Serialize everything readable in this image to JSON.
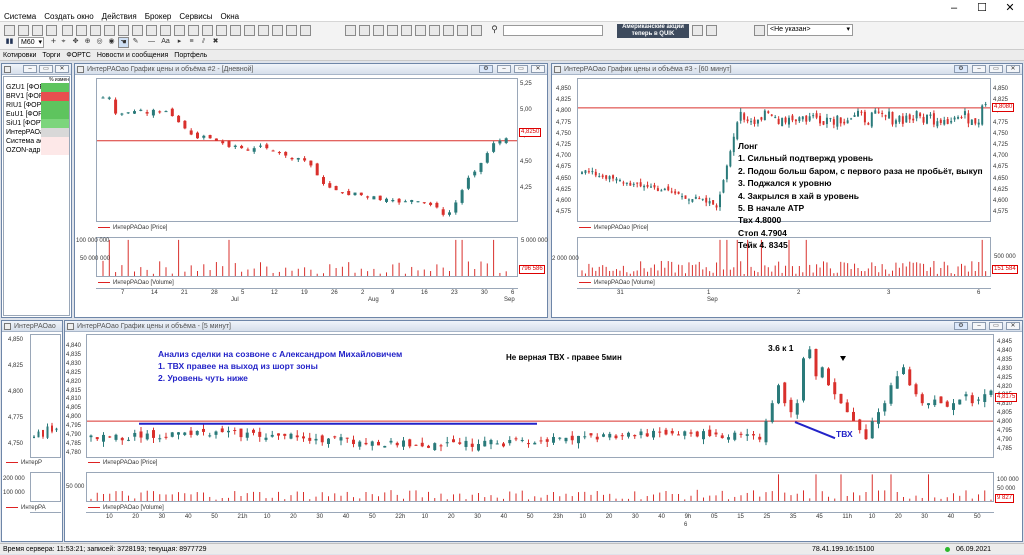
{
  "menu": {
    "items": [
      "Система",
      "Создать окно",
      "Действия",
      "Брокер",
      "Сервисы",
      "Окна"
    ]
  },
  "toolbar": {
    "interval": "M60",
    "banner_line1": "Американские акции",
    "banner_line2": "теперь в QUIK",
    "account_select": "<Не указан>"
  },
  "tabs": [
    "Котировки",
    "Торги",
    "ФОРТС",
    "Новости и сообщения",
    "Портфель"
  ],
  "watchlist": {
    "header": "% измен",
    "rows": [
      {
        "name": "GZU1 [ФОРТ",
        "color": "#5ec45e"
      },
      {
        "name": "BRV1 [ФОРТ",
        "color": "#e84f4f"
      },
      {
        "name": "RIU1 [ФОРТ",
        "color": "#5ec45e"
      },
      {
        "name": "EuU1 [ФОРТ",
        "color": "#5ec45e"
      },
      {
        "name": "SiU1 [ФОРТ",
        "color": "#7cd57c"
      },
      {
        "name": "ИнтерРАОао",
        "color": "#d8d8d8"
      },
      {
        "name": "Система ао",
        "color": "#fde8e8"
      },
      {
        "name": "OZON-адр [М",
        "color": "#fde8e8"
      }
    ]
  },
  "window_daily": {
    "title": "ИнтерРАОао График цены и объёма #2 - [Дневной]",
    "y_ticks": [
      "5,25",
      "5,00",
      "4,75",
      "4,50",
      "4,25"
    ],
    "last_price": "4,8250",
    "price_legend": "ИнтерРАОао [Price]",
    "volume_legend": "ИнтерРАОао [Volume]",
    "vol_ticks": [
      "100 000 000",
      "50 000 000"
    ],
    "vol_ticks_right": [
      "5 000 000",
      "0 000 000"
    ],
    "vol_box": "796 586",
    "x_days": [
      "7",
      "14",
      "21",
      "28",
      "5",
      "12",
      "19",
      "26",
      "2",
      "9",
      "16",
      "23",
      "30",
      "6"
    ],
    "x_months": [
      "Jul",
      "Aug",
      "Sep"
    ]
  },
  "window_60": {
    "title": "ИнтерРАОао График цены и объёма #3 - [60 минут]",
    "y_ticks": [
      "4,850",
      "4,825",
      "4,800",
      "4,775",
      "4,750",
      "4,725",
      "4,700",
      "4,675",
      "4,650",
      "4,625",
      "4,600",
      "4,575"
    ],
    "y_ticks_left": [
      "4,850",
      "4,825",
      "4,800",
      "4,775",
      "4,750",
      "4,725",
      "4,700",
      "4,675",
      "4,650",
      "4,625",
      "4,600",
      "4,575"
    ],
    "last_price": "4,8080",
    "price_legend": "ИнтерРАОао [Price]",
    "volume_legend": "ИнтерРАОао [Volume]",
    "vol_tick_left": "2 000 000",
    "vol_tick_right": "500 000",
    "vol_box": "151 584",
    "x_labels": [
      "31",
      "1",
      "2",
      "3",
      "6"
    ],
    "x_month": "Sep",
    "notes": [
      "Лонг",
      "1. Сильный подтвержд уровень",
      "2. Подош больш баром, с первого раза не пробьёт, выкуп",
      "3. Поджался к уровню",
      "4. Закрылся в хай в уровень",
      "5. В начале АТР",
      "Твх 4.8000",
      "Стоп 4.7904",
      "Тейк 4. 8345"
    ]
  },
  "window_small": {
    "title": "ИнтерРАОао",
    "y_ticks": [
      "4,850",
      "4,825",
      "4,800",
      "4,775",
      "4,750"
    ],
    "vol_ticks": [
      "200 000",
      "100 000"
    ],
    "price_legend": "ИнтерР",
    "volume_legend": "ИнтерРА"
  },
  "window_5m": {
    "title": "ИнтерРАОао График цены и объёма - [5 минут]",
    "y_ticks": [
      "4,845",
      "4,840",
      "4,835",
      "4,830",
      "4,825",
      "4,820",
      "4,815",
      "4,810",
      "4,805",
      "4,800",
      "4,795",
      "4,790",
      "4,785"
    ],
    "y_ticks_left": [
      "4,840",
      "4,835",
      "4,830",
      "4,825",
      "4,820",
      "4,815",
      "4,810",
      "4,805",
      "4,800",
      "4,795",
      "4,790",
      "4,785",
      "4,780"
    ],
    "last_price": "4,8175",
    "price_legend": "ИнтерРАОао [Price]",
    "volume_legend": "ИнтерРАОао [Volume]",
    "vol_tick_left": "50 000",
    "vol_ticks_right": [
      "100 000",
      "50 000"
    ],
    "vol_box": "9 827",
    "x_labels": [
      "10",
      "20",
      "30",
      "40",
      "50",
      "21h",
      "10",
      "20",
      "30",
      "40",
      "50",
      "22h",
      "10",
      "20",
      "30",
      "40",
      "50",
      "23h",
      "10",
      "20",
      "30",
      "40",
      "9h",
      "05",
      "15",
      "25",
      "35",
      "45",
      "11h",
      "10",
      "20",
      "30",
      "40",
      "50"
    ],
    "x_day": "6",
    "note_blue_1": "Анализ сделки на созвоне с Александром Михайловичем",
    "note_blue_2": "1. ТВХ правее на выход из шорт зоны",
    "note_blue_3": "2. Уровень чуть ниже",
    "note_black": "Не верная ТВХ - правее 5мин",
    "note_ratio": "3.6 к 1",
    "note_tvx": "ТВХ"
  },
  "status": {
    "server_time": "Время сервера: 11:53:21; записей: 3728193; текущая: 8977729",
    "ip": "78.41.199.16:15100",
    "date": "06.09.2021"
  },
  "chart_data": [
    {
      "type": "candlestick",
      "title": "ИнтерРАОао График цены и объёма #2 - [Дневной]",
      "series": [
        {
          "name": "ИнтерРАОао [Price]"
        }
      ],
      "ylim": [
        4.15,
        5.3
      ],
      "x_month_labels": [
        "Jul",
        "Aug",
        "Sep"
      ],
      "horizontal_line": 4.8,
      "last_value": 4.825
    },
    {
      "type": "candlestick",
      "title": "ИнтерРАОао График цены и объёма #3 - [60 минут]",
      "series": [
        {
          "name": "ИнтерРАОао [Price]"
        }
      ],
      "ylim": [
        4.565,
        4.86
      ],
      "horizontal_line": 4.8,
      "last_value": 4.808
    },
    {
      "type": "candlestick",
      "title": "ИнтерРАОао График цены и объёма - [5 минут]",
      "series": [
        {
          "name": "ИнтерРАОао [Price]"
        }
      ],
      "ylim": [
        4.78,
        4.848
      ],
      "horizontal_line": 4.8,
      "last_value": 4.8175
    }
  ]
}
